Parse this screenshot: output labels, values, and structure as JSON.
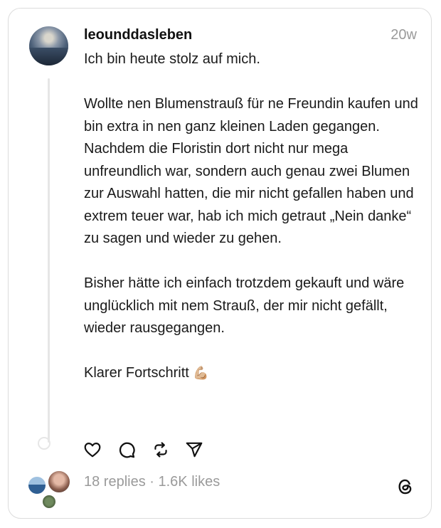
{
  "post": {
    "username": "leounddasleben",
    "time": "20w",
    "paragraphs": [
      "Ich bin heute stolz auf mich.",
      "",
      "Wollte nen Blumenstrauß für ne Freundin kaufen und bin extra in nen ganz kleinen Laden gegangen.",
      "Nachdem die Floristin dort nicht nur mega unfreundlich war, sondern auch genau zwei Blumen zur Auswahl hatten, die mir nicht gefallen haben und extrem teuer war, hab ich mich getraut „Nein danke“ zu sagen und wieder zu gehen.",
      "",
      "Bisher hätte ich einfach trotzdem gekauft und wäre unglücklich mit nem Strauß, der mir nicht gefällt, wieder rausgegangen.",
      "",
      "Klarer Fortschritt"
    ],
    "emoji": "💪🏼",
    "stats": "18 replies · 1.6K likes"
  },
  "icons": {
    "like": "heart-icon",
    "reply": "comment-icon",
    "repost": "repost-icon",
    "share": "send-icon",
    "brand": "threads-logo-icon"
  }
}
